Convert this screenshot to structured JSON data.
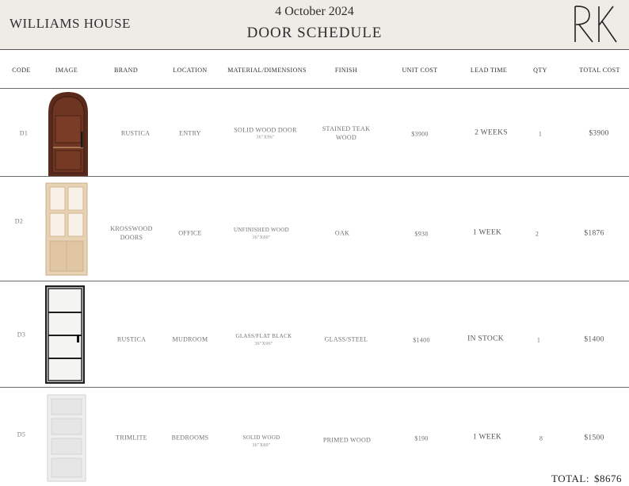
{
  "header": {
    "project": "WILLIAMS HOUSE",
    "date": "4 October 2024",
    "title": "DOOR SCHEDULE"
  },
  "columns": {
    "code": "CODE",
    "image": "IMAGE",
    "brand": "BRAND",
    "location": "LOCATION",
    "material": "MATERIAL/DIMENSIONS",
    "finish": "FINISH",
    "unit_cost": "UNIT COST",
    "lead_time": "LEAD TIME",
    "qty": "QTY",
    "total_cost": "TOTAL COST"
  },
  "rows": [
    {
      "code": "D1",
      "image": "arched-wood-door-image",
      "brand": "RUSTICA",
      "location": "ENTRY",
      "material": "SOLID WOOD DOOR",
      "dimensions": "36\"X96\"",
      "finish": "STAINED TEAK WOOD",
      "unit_cost": "$3900",
      "lead_time": "2 WEEKS",
      "qty": "1",
      "total_cost": "$3900"
    },
    {
      "code": "D2",
      "image": "glass-panel-wood-door-image",
      "brand": "KROSSWOOD DOORS",
      "location": "OFFICE",
      "material": "UNFINISHED WOOD",
      "dimensions": "36\"X80\"",
      "finish": "OAK",
      "unit_cost": "$938",
      "lead_time": "1 WEEK",
      "qty": "2",
      "total_cost": "$1876"
    },
    {
      "code": "D3",
      "image": "steel-glass-door-image",
      "brand": "RUSTICA",
      "location": "MUDROOM",
      "material": "GLASS/FLAT BLACK",
      "dimensions": "36\"X96\"",
      "finish": "GLASS/STEEL",
      "unit_cost": "$1400",
      "lead_time": "IN STOCK",
      "qty": "1",
      "total_cost": "$1400"
    },
    {
      "code": "D5",
      "image": "white-shaker-door-image",
      "brand": "TRIMLITE",
      "location": "BEDROOMS",
      "material": "SOLID WOOD",
      "dimensions": "36\"X80\"",
      "finish": "PRIMED WOOD",
      "unit_cost": "$190",
      "lead_time": "1 WEEK",
      "qty": "8",
      "total_cost": "$1500"
    }
  ],
  "footer": {
    "total_label": "TOTAL:",
    "total_value": "$8676"
  },
  "colors": {
    "header_bg": "#efece7",
    "wood_dark": "#5a2a1a",
    "wood_light": "#e8d2b4",
    "steel": "#1e1e1e",
    "primed": "#eeeeee"
  }
}
